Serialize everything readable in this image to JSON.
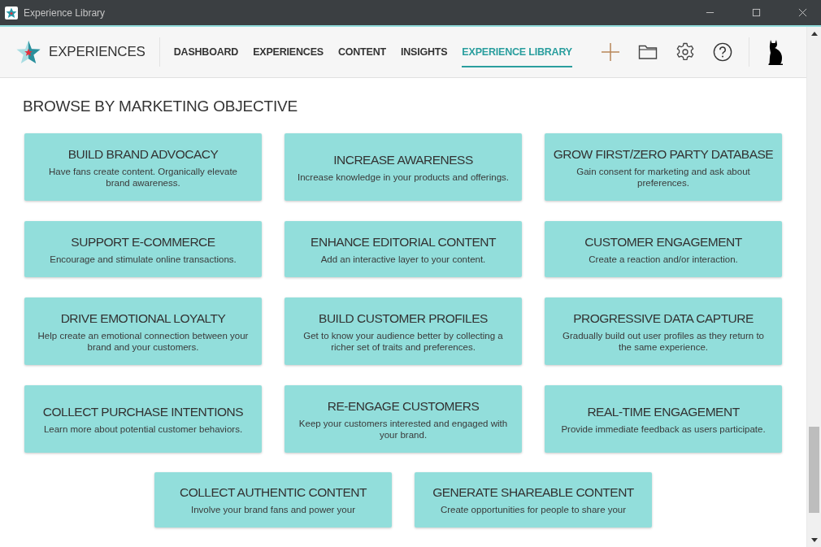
{
  "window": {
    "title": "Experience Library"
  },
  "brand": "EXPERIENCES",
  "nav": [
    {
      "label": "DASHBOARD",
      "selected": false
    },
    {
      "label": "EXPERIENCES",
      "selected": false
    },
    {
      "label": "CONTENT",
      "selected": false
    },
    {
      "label": "INSIGHTS",
      "selected": false
    },
    {
      "label": "EXPERIENCE LIBRARY",
      "selected": true
    }
  ],
  "section_title": "BROWSE BY MARKETING OBJECTIVE",
  "objectives": [
    {
      "title": "BUILD BRAND ADVOCACY",
      "description": "Have fans create content. Organically elevate brand awareness."
    },
    {
      "title": "INCREASE AWARENESS",
      "description": "Increase knowledge in your products and offerings."
    },
    {
      "title": "GROW FIRST/ZERO PARTY DATABASE",
      "description": "Gain consent for marketing and ask about preferences."
    },
    {
      "title": "SUPPORT E-COMMERCE",
      "description": "Encourage and stimulate online transactions."
    },
    {
      "title": "ENHANCE EDITORIAL CONTENT",
      "description": "Add an interactive layer to your content."
    },
    {
      "title": "CUSTOMER ENGAGEMENT",
      "description": "Create a reaction and/or interaction."
    },
    {
      "title": "DRIVE EMOTIONAL LOYALTY",
      "description": "Help create an emotional connection between your brand and your customers."
    },
    {
      "title": "BUILD CUSTOMER PROFILES",
      "description": "Get to know your audience better by collecting a richer set of traits and preferences."
    },
    {
      "title": "PROGRESSIVE DATA CAPTURE",
      "description": "Gradually build out user profiles as they return to the same experience."
    },
    {
      "title": "COLLECT PURCHASE INTENTIONS",
      "description": "Learn more about potential customer behaviors."
    },
    {
      "title": "RE-ENGAGE CUSTOMERS",
      "description": "Keep your customers interested and engaged with your brand."
    },
    {
      "title": "REAL-TIME ENGAGEMENT",
      "description": "Provide immediate feedback as users participate."
    },
    {
      "title": "COLLECT AUTHENTIC CONTENT",
      "description": "Involve your brand fans and power your"
    },
    {
      "title": "GENERATE SHAREABLE CONTENT",
      "description": "Create opportunities for people to share your"
    }
  ]
}
